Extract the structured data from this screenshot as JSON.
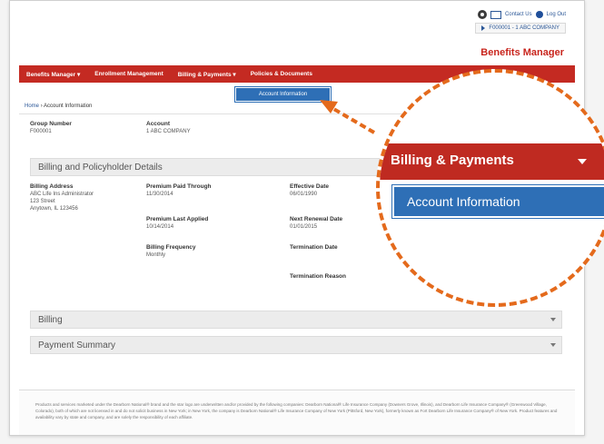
{
  "utility": {
    "contact_label": "Contact Us",
    "logout_label": "Log Out",
    "account_selector": "F000001 - 1 ABC COMPANY"
  },
  "brand": {
    "title": "Benefits Manager"
  },
  "nav": {
    "items": [
      {
        "label": "Benefits Manager ▾"
      },
      {
        "label": "Enrollment Management"
      },
      {
        "label": "Billing & Payments ▾"
      },
      {
        "label": "Policies & Documents"
      }
    ],
    "submenu_label": "Account Information"
  },
  "breadcrumb": {
    "home": "Home",
    "separator": "›",
    "current": "Account Information"
  },
  "summary": {
    "group_label": "Group Number",
    "group_value": "F000001",
    "account_label": "Account",
    "account_value": "1 ABC COMPANY"
  },
  "details": {
    "section_title": "Billing and Policyholder Details",
    "billing_address_label": "Billing Address",
    "billing_address_lines": [
      "ABC Life Ins Administrator",
      "123 Street",
      "Anytown, IL 123456"
    ],
    "premium_paid_label": "Premium Paid Through",
    "premium_paid_value": "11/30/2014",
    "premium_applied_label": "Premium Last Applied",
    "premium_applied_value": "10/14/2014",
    "billing_frequency_label": "Billing Frequency",
    "billing_frequency_value": "Monthly",
    "effective_date_label": "Effective Date",
    "effective_date_value": "06/01/1990",
    "renewal_date_label": "Next Renewal Date",
    "renewal_date_value": "01/01/2015",
    "termination_date_label": "Termination Date",
    "termination_reason_label": "Termination Reason"
  },
  "sections": {
    "billing": "Billing",
    "payment_summary": "Payment Summary"
  },
  "footer": {
    "text": "Products and services marketed under the Dearborn National® brand and the star logo are underwritten and/or provided by the following companies: Dearborn National® Life Insurance Company (Downers Grove, Illinois), and Dearborn Life Insurance Company® (Greenwood Village, Colorado), both of which are not licensed in and do not solicit business in New York; in New York, the company is Dearborn National® Life Insurance Company of New York (Pittsford, New York), formerly known as Fort Dearborn Life Insurance Company® of New York. Product features and availability vary by state and company, and are solely the responsibility of each affiliate."
  },
  "zoom": {
    "menu_label": "Billing & Payments",
    "submenu_label": "Account Information"
  },
  "colors": {
    "nav_red": "#c42a22",
    "submenu_blue": "#2e6fb6",
    "callout_orange": "#e46a1c",
    "brand_red": "#c8241c"
  }
}
